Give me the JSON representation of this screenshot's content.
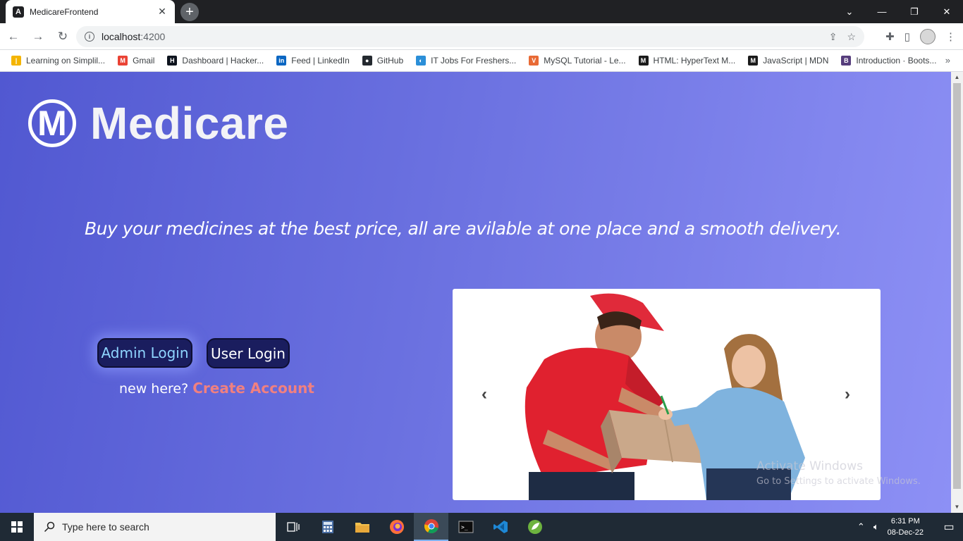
{
  "browser": {
    "tab_title": "MedicareFrontend",
    "url_host": "localhost",
    "url_port": ":4200"
  },
  "bookmarks": [
    {
      "label": "Learning on Simplil...",
      "color": "#f4b400",
      "glyph": "|"
    },
    {
      "label": "Gmail",
      "color": "#ea4335",
      "glyph": "M"
    },
    {
      "label": "Dashboard | Hacker...",
      "color": "#0e141e",
      "glyph": "H"
    },
    {
      "label": "Feed | LinkedIn",
      "color": "#0a66c2",
      "glyph": "in"
    },
    {
      "label": "GitHub",
      "color": "#24292f",
      "glyph": "●"
    },
    {
      "label": "IT Jobs For Freshers...",
      "color": "#2b8fd8",
      "glyph": "◐"
    },
    {
      "label": "MySQL Tutorial - Le...",
      "color": "#e86a35",
      "glyph": "V"
    },
    {
      "label": "HTML: HyperText M...",
      "color": "#1b1b1b",
      "glyph": "M"
    },
    {
      "label": "JavaScript | MDN",
      "color": "#1b1b1b",
      "glyph": "M"
    },
    {
      "label": "Introduction · Boots...",
      "color": "#563d7c",
      "glyph": "B"
    }
  ],
  "page": {
    "brand": "Medicare",
    "brand_mark": "M",
    "tagline": "Buy your medicines at the best price, all are avilable at one place and a smooth delivery.",
    "admin_login": "Admin Login",
    "user_login": "User Login",
    "signup_prompt": "new here?",
    "signup_link": "Create Account",
    "carousel_prev": "‹",
    "carousel_next": "›"
  },
  "watermark": {
    "line1": "Activate Windows",
    "line2": "Go to Settings to activate Windows."
  },
  "taskbar": {
    "search_placeholder": "Type here to search",
    "time": "6:31 PM",
    "date": "08-Dec-22"
  },
  "colors": {
    "bg_start": "#5158d1",
    "bg_end": "#8d90f5",
    "button_bg": "#1a1d5e",
    "admin_text": "#8fd5ff",
    "link": "#f08080"
  }
}
